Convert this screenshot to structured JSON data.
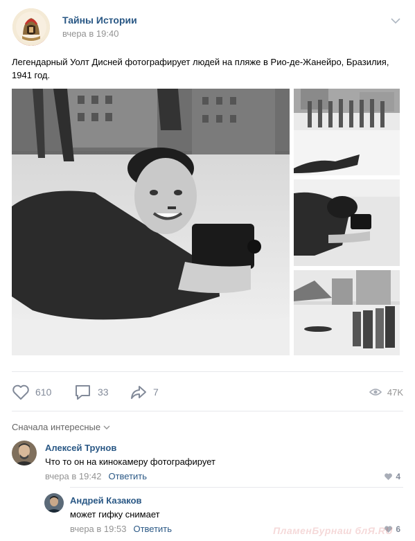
{
  "post": {
    "group_name": "Тайны Истории",
    "time": "вчера в 19:40",
    "text": "Легендарный Уолт Дисней фотографирует людей на пляже в Рио-де-Жанейро, Бразилия, 1941 год."
  },
  "actions": {
    "likes": "610",
    "comments": "33",
    "shares": "7",
    "views": "47K"
  },
  "comments_sort": "Сначала интересные",
  "comments": [
    {
      "author": "Алексей Трунов",
      "text": "Что то он на кинокамеру фотографирует",
      "time": "вчера в 19:42",
      "reply": "Ответить",
      "likes": "4"
    },
    {
      "author": "Андрей Казаков",
      "text": "может гифку снимает",
      "time": "вчера в 19:53",
      "reply": "Ответить",
      "likes": "6"
    }
  ],
  "watermark": "ПламенБурнаш блЯ.RU",
  "colors": {
    "link": "#2a5885",
    "muted": "#939393",
    "icon": "#828a99"
  },
  "icons": [
    "chevron-down-icon",
    "heart-icon",
    "comment-icon",
    "share-icon",
    "eye-icon"
  ]
}
